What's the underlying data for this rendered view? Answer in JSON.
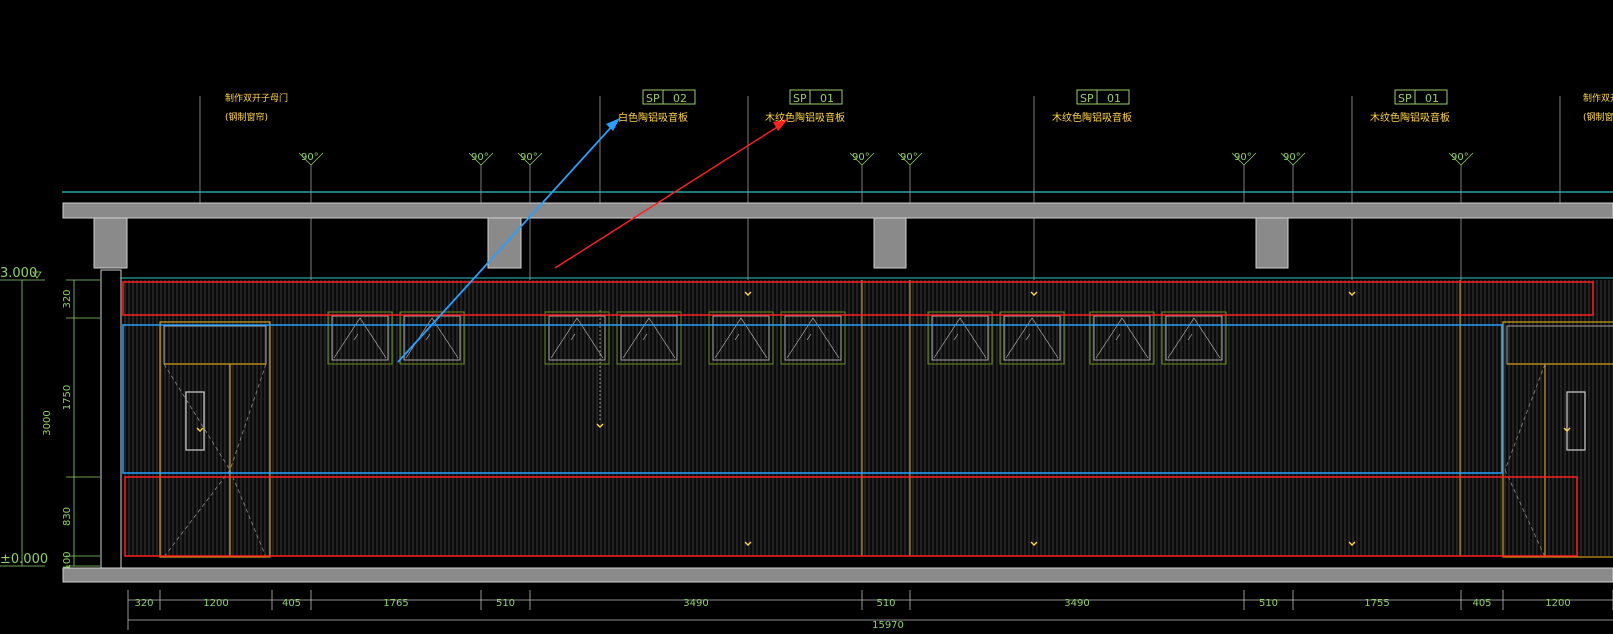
{
  "colors": {
    "background": "#000000",
    "note_text": "#ffd54a",
    "dimension": "#8fd16a",
    "tag": "#9ccc65",
    "line": "#bdbdbd",
    "cyan": "#2ec4c4",
    "red_box": "#ff2020",
    "blue_box": "#28a0ff",
    "gold": "#d4a017",
    "beam": "#8a8a8a"
  },
  "annotations": [
    {
      "id": "door-left",
      "line1": "制作双开子母门",
      "line2": "(钢制窗帘)"
    },
    {
      "id": "sp02",
      "tag_a": "SP",
      "tag_b": "02",
      "label": "白色陶铝吸音板"
    },
    {
      "id": "sp01-a",
      "tag_a": "SP",
      "tag_b": "01",
      "label": "木纹色陶铝吸音板"
    },
    {
      "id": "sp01-b",
      "tag_a": "SP",
      "tag_b": "01",
      "label": "木纹色陶铝吸音板"
    },
    {
      "id": "sp01-c",
      "tag_a": "SP",
      "tag_b": "01",
      "label": "木纹色陶铝吸音板"
    },
    {
      "id": "door-right",
      "line1": "制作双开",
      "line2": "(钢制窗帘"
    }
  ],
  "angle_label": "90°",
  "levels": {
    "top": "3.000",
    "bottom": "±0.000"
  },
  "vertical_dims": [
    "320",
    "1750",
    "830",
    "100"
  ],
  "total_height": "3000",
  "horizontal_dims": [
    "320",
    "1200",
    "405",
    "1765",
    "510",
    "3490",
    "510",
    "3490",
    "510",
    "1755",
    "405",
    "1200"
  ],
  "total_width": "15970"
}
